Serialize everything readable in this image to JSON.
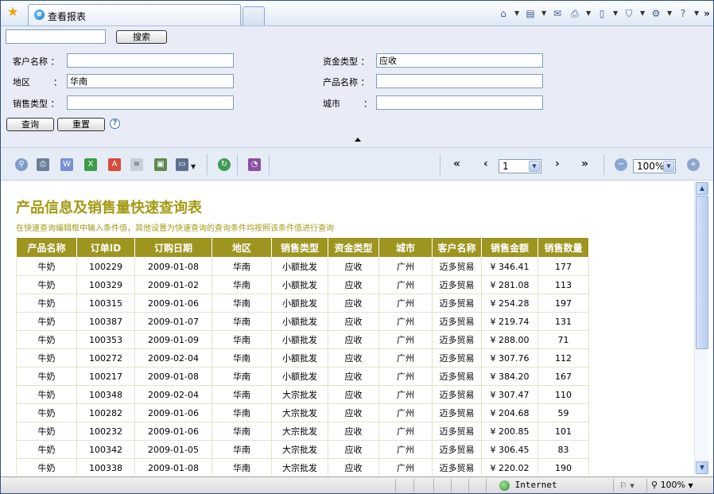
{
  "browser": {
    "tab_title": "查看报表",
    "status_zone": "Internet",
    "status_zoom": "100%",
    "command_icons": [
      "home-icon",
      "feeds-icon",
      "mail-icon",
      "print-icon",
      "page-icon",
      "safety-icon",
      "tools-icon",
      "help-icon"
    ]
  },
  "query": {
    "search_value": "",
    "search_button": "搜索",
    "fields": {
      "customer_name": {
        "label": "客户名称 ：",
        "value": ""
      },
      "fund_type": {
        "label": "资金类型 ：",
        "value": "应收"
      },
      "region": {
        "label": "地区",
        "colon": "：",
        "value": "华南"
      },
      "product_name": {
        "label": "产品名称 ：",
        "value": ""
      },
      "sales_type": {
        "label": "销售类型 ：",
        "value": ""
      },
      "city": {
        "label": "城市",
        "colon": "：",
        "value": ""
      }
    },
    "query_button": "查询",
    "reset_button": "重置",
    "help_glyph": "?"
  },
  "toolbar": {
    "nav_first": "«",
    "nav_prev": "‹",
    "page_value": "1",
    "nav_next": "›",
    "nav_last": "»",
    "zoom_value": "100%"
  },
  "report": {
    "title": "产品信息及销售量快速查询表",
    "subtitle": "在快速查询编辑框中输入条件值，其他设置为快速查询的查询条件均按照该条件值进行查询",
    "header_color": "#9d9520",
    "columns": [
      "产品名称",
      "订单ID",
      "订购日期",
      "地区",
      "销售类型",
      "资金类型",
      "城市",
      "客户名称",
      "销售金额",
      "销售数量"
    ],
    "rows": [
      [
        "牛奶",
        "100229",
        "2009-01-08",
        "华南",
        "小额批发",
        "应收",
        "广州",
        "迈多贸易",
        "¥ 346.41",
        "177"
      ],
      [
        "牛奶",
        "100329",
        "2009-01-02",
        "华南",
        "小额批发",
        "应收",
        "广州",
        "迈多贸易",
        "¥ 281.08",
        "113"
      ],
      [
        "牛奶",
        "100315",
        "2009-01-06",
        "华南",
        "小额批发",
        "应收",
        "广州",
        "迈多贸易",
        "¥ 254.28",
        "197"
      ],
      [
        "牛奶",
        "100387",
        "2009-01-07",
        "华南",
        "小额批发",
        "应收",
        "广州",
        "迈多贸易",
        "¥ 219.74",
        "131"
      ],
      [
        "牛奶",
        "100353",
        "2009-01-09",
        "华南",
        "小额批发",
        "应收",
        "广州",
        "迈多贸易",
        "¥ 288.00",
        "71"
      ],
      [
        "牛奶",
        "100272",
        "2009-02-04",
        "华南",
        "小额批发",
        "应收",
        "广州",
        "迈多贸易",
        "¥ 307.76",
        "112"
      ],
      [
        "牛奶",
        "100217",
        "2009-01-08",
        "华南",
        "小额批发",
        "应收",
        "广州",
        "迈多贸易",
        "¥ 384.20",
        "167"
      ],
      [
        "牛奶",
        "100348",
        "2009-02-04",
        "华南",
        "大宗批发",
        "应收",
        "广州",
        "迈多贸易",
        "¥ 307.47",
        "110"
      ],
      [
        "牛奶",
        "100282",
        "2009-01-06",
        "华南",
        "大宗批发",
        "应收",
        "广州",
        "迈多贸易",
        "¥ 204.68",
        "59"
      ],
      [
        "牛奶",
        "100232",
        "2009-01-06",
        "华南",
        "大宗批发",
        "应收",
        "广州",
        "迈多贸易",
        "¥ 200.85",
        "101"
      ],
      [
        "牛奶",
        "100342",
        "2009-01-05",
        "华南",
        "大宗批发",
        "应收",
        "广州",
        "迈多贸易",
        "¥ 306.45",
        "83"
      ],
      [
        "牛奶",
        "100338",
        "2009-01-08",
        "华南",
        "大宗批发",
        "应收",
        "广州",
        "迈多贸易",
        "¥ 220.02",
        "190"
      ]
    ]
  }
}
